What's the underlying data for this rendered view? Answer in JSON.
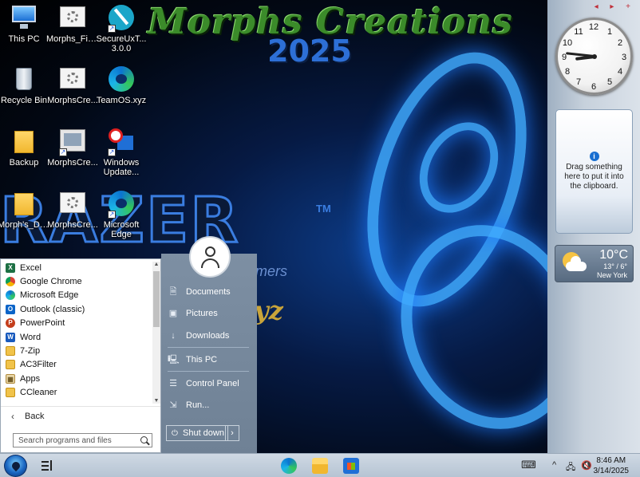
{
  "wallpaper": {
    "title": "Morphs Creations",
    "year": "2025",
    "brand": "RAZER",
    "tm": "TM",
    "tagline": "mers",
    "yz": "yz"
  },
  "desktop_icons": [
    {
      "label": "This PC",
      "icon": "computer-icon"
    },
    {
      "label": "Morphs_Fire...",
      "icon": "settings-file-icon"
    },
    {
      "label": "SecureUxT... 3.0.0",
      "icon": "brush-app-icon"
    },
    {
      "label": "Recycle Bin",
      "icon": "recycle-bin-icon"
    },
    {
      "label": "MorphsCre...",
      "icon": "settings-file-icon"
    },
    {
      "label": "TeamOS.xyz",
      "icon": "edge-icon"
    },
    {
      "label": "Backup",
      "icon": "folder-icon"
    },
    {
      "label": "MorphsCre...",
      "icon": "app-shortcut-icon"
    },
    {
      "label": "Windows Update...",
      "icon": "blocked-update-icon"
    },
    {
      "label": "Morph's_De...",
      "icon": "folder-icon"
    },
    {
      "label": "MorphsCre...",
      "icon": "settings-file-icon"
    },
    {
      "label": "Microsoft Edge",
      "icon": "edge-icon"
    }
  ],
  "sidebar": {
    "controls": "◂ ▸ +",
    "clock": {
      "hour": 8,
      "minute": 46
    },
    "clock_numbers": [
      "12",
      "1",
      "2",
      "3",
      "4",
      "5",
      "6",
      "7",
      "8",
      "9",
      "10",
      "11"
    ],
    "clipboard_text": "Drag something here to put it into the clipboard.",
    "weather": {
      "temp": "10°C",
      "hilo": "13° / 6°",
      "city": "New York"
    }
  },
  "start_menu": {
    "programs": [
      {
        "label": "Excel",
        "color": "#1d7044",
        "glyph": "X"
      },
      {
        "label": "Google Chrome",
        "color": "#db4437",
        "glyph": "●"
      },
      {
        "label": "Microsoft Edge",
        "color": "#0b74d1",
        "glyph": "e"
      },
      {
        "label": "Outlook (classic)",
        "color": "#0a64c8",
        "glyph": "O"
      },
      {
        "label": "PowerPoint",
        "color": "#c43e1c",
        "glyph": "P"
      },
      {
        "label": "Word",
        "color": "#185abd",
        "glyph": "W"
      },
      {
        "label": "7-Zip",
        "color": "#f1c34a",
        "glyph": ""
      },
      {
        "label": "AC3Filter",
        "color": "#f1c34a",
        "glyph": ""
      },
      {
        "label": "Apps",
        "color": "#c9a86a",
        "glyph": "▦"
      },
      {
        "label": "CCleaner",
        "color": "#f1c34a",
        "glyph": ""
      }
    ],
    "back_label": "Back",
    "search_placeholder": "Search programs and files",
    "right_items": [
      {
        "label": "Documents",
        "glyph": "🗎"
      },
      {
        "label": "Pictures",
        "glyph": "▣"
      },
      {
        "label": "Downloads",
        "glyph": "↓"
      },
      {
        "label": "This PC",
        "glyph": "🖳"
      },
      {
        "label": "Control Panel",
        "glyph": "☰"
      },
      {
        "label": "Run...",
        "glyph": "⇲"
      }
    ],
    "shutdown_label": "Shut down",
    "shutdown_arrow": "›"
  },
  "taskbar": {
    "time": "8:46 AM",
    "date": "3/14/2025",
    "tray": {
      "keyboard": "⌨",
      "chevron": "^",
      "network": "🖧",
      "volume": "🔇"
    }
  }
}
